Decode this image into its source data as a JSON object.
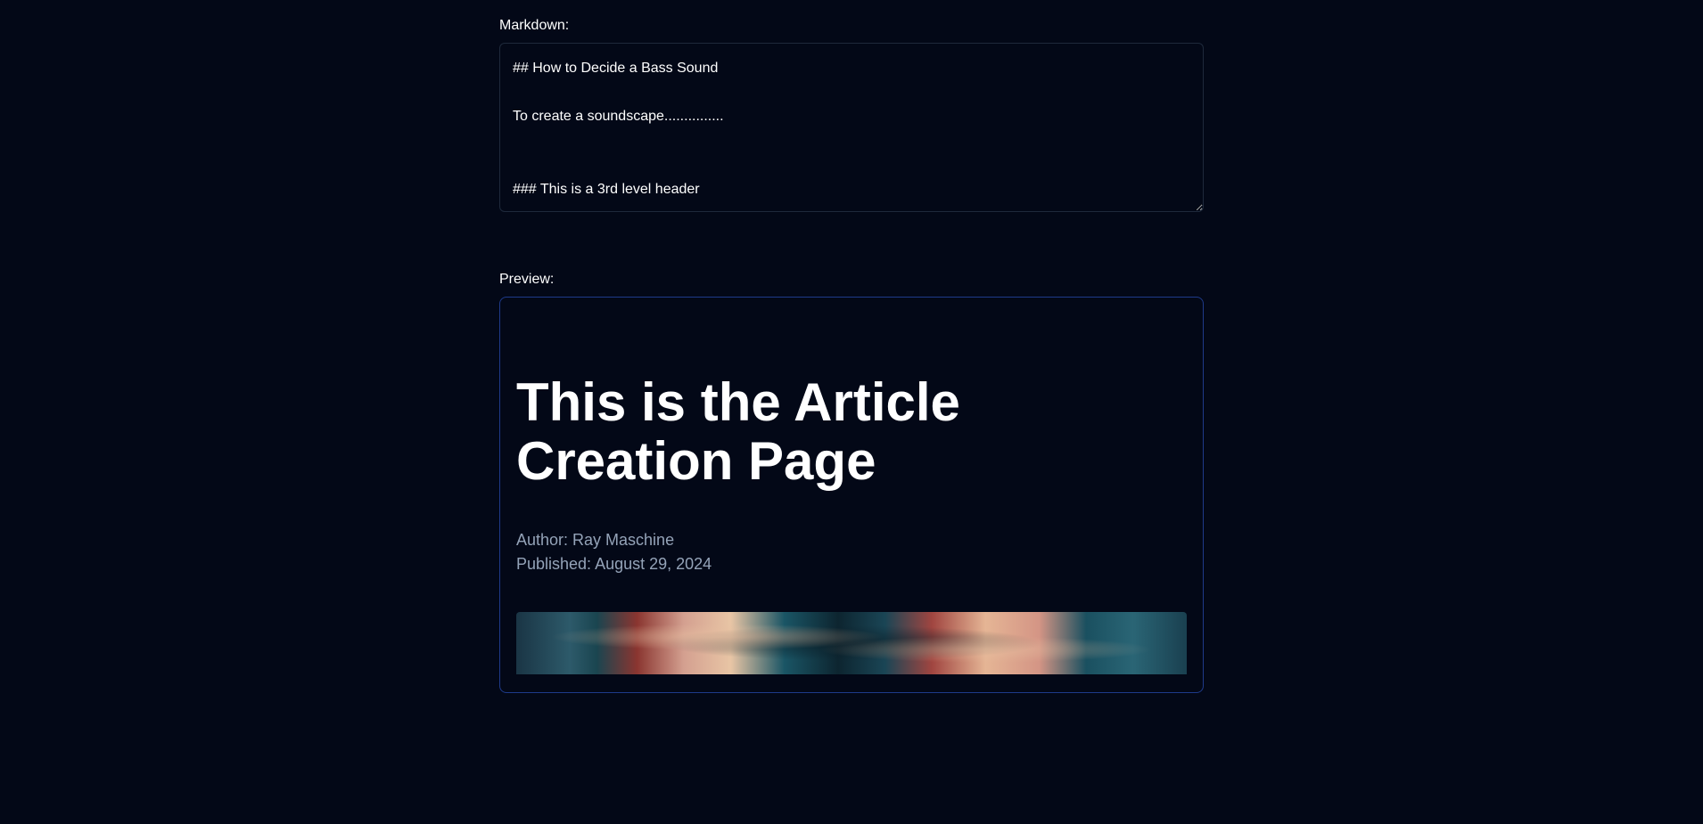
{
  "markdown": {
    "label": "Markdown:",
    "content": "## How to Decide a Bass Sound\n\nTo create a soundscape...............\n\n\n### This is a 3rd level header\n\n![This is an image](https://lunacy.audio/wp-content/uploads/2022/10/shutterstock_2002639829-scaled.jpg)"
  },
  "preview": {
    "label": "Preview:",
    "title": "This is the Article Creation Page",
    "author_line": "Author: Ray Maschine",
    "published_line": "Published: August 29, 2024"
  }
}
